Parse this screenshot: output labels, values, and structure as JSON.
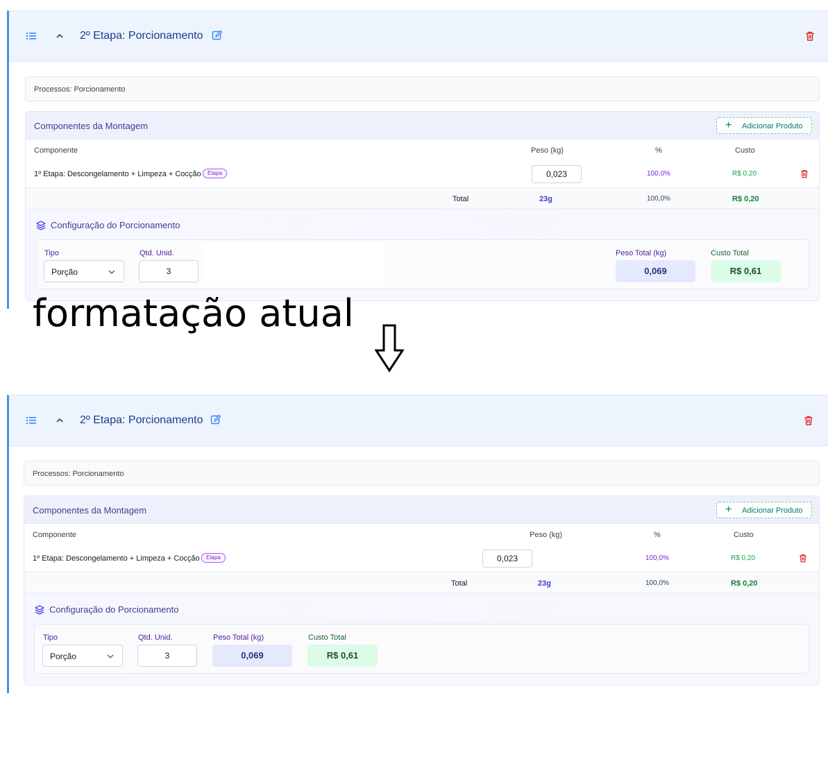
{
  "top_card": {
    "stage_title": "2º Etapa: Porcionamento",
    "processos": "Processos: Porcionamento",
    "components_title": "Componentes da Montagem",
    "add_button": "Adicionar Produto",
    "headers": {
      "componente": "Componente",
      "peso": "Peso (kg)",
      "pct": "%",
      "custo": "Custo"
    },
    "row": {
      "name": "1º Etapa: Descongelamento + Limpeza + Cocção",
      "badge": "Etapa",
      "peso": "0,023",
      "pct": "100,0%",
      "custo": "R$ 0,20"
    },
    "total": {
      "label": "Total",
      "peso": "23g",
      "pct": "100,0%",
      "custo": "R$ 0,20"
    },
    "config_title": "Configuração do Porcionamento",
    "tipo_label": "Tipo",
    "tipo_value": "Porção",
    "qtd_label": "Qtd. Unid.",
    "qtd_value": "3",
    "peso_total_label": "Peso Total (kg)",
    "peso_total_value": "0,069",
    "custo_total_label": "Custo Total",
    "custo_total_value": "R$ 0,61"
  },
  "bottom_card": {
    "stage_title": "2º Etapa: Porcionamento",
    "processos": "Processos: Porcionamento",
    "components_title": "Componentes da Montagem",
    "add_button": "Adicionar Produto",
    "headers": {
      "componente": "Componente",
      "peso": "Peso (kg)",
      "pct": "%",
      "custo": "Custo"
    },
    "row": {
      "name": "1º Etapa: Descongelamento + Limpeza + Cocção",
      "badge": "Etapa",
      "peso": "0,023",
      "pct": "100,0%",
      "custo": "R$ 0,20"
    },
    "total": {
      "label": "Total",
      "peso": "23g",
      "pct": "100,0%",
      "custo": "R$ 0,20"
    },
    "config_title": "Configuração do Porcionamento",
    "tipo_label": "Tipo",
    "tipo_value": "Porção",
    "qtd_label": "Qtd. Unid.",
    "qtd_value": "3",
    "peso_total_label": "Peso Total (kg)",
    "peso_total_value": "0,069",
    "custo_total_label": "Custo Total",
    "custo_total_value": "R$ 0,61"
  },
  "annotation": "formatação atual",
  "icons": {
    "list": "list-icon",
    "collapse": "chevron-up-icon",
    "edit": "edit-icon",
    "delete": "trash-icon",
    "layers": "layers-icon",
    "add": "plus-icon",
    "dropdown": "chevron-down-icon",
    "arrow": "arrow-down-icon"
  },
  "colors": {
    "accent_blue": "#4a90e2",
    "header_bg": "#edf4fe",
    "title_blue": "#1e3a8a",
    "danger_red": "#dc2626",
    "success_green": "#16a34a",
    "purple": "#7e22ce"
  }
}
